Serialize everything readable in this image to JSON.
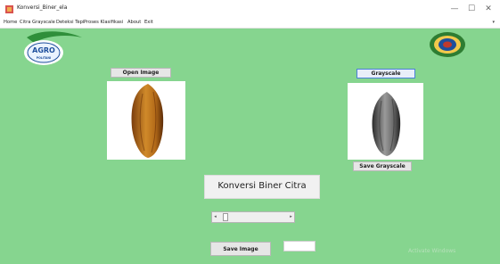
{
  "window": {
    "title": "Konversi_Biner_ela",
    "minimize_label": "—",
    "maximize_label": "☐",
    "close_label": "✕"
  },
  "menu": {
    "items": [
      {
        "label": "Home"
      },
      {
        "label": "Citra Grayscale"
      },
      {
        "label": "Deteksi Tepi"
      },
      {
        "label": "Proses Klasifikasi"
      },
      {
        "label": "About"
      },
      {
        "label": "Exit"
      }
    ],
    "overflow_label": "▾"
  },
  "logos": {
    "agro_text": "AGRO",
    "agro_subtext": "POLITANI"
  },
  "buttons": {
    "open_image": "Open Image",
    "grayscale": "Grayscale",
    "save_grayscale": "Save Grayscale",
    "save_image": "Save Image"
  },
  "main": {
    "title": "Konversi Biner Citra"
  },
  "slider": {
    "left_arrow": "◂",
    "right_arrow": "▸",
    "value_fraction": 0.05
  },
  "result": {
    "value": ""
  },
  "watermark": {
    "text": "Activate Windows"
  },
  "colors": {
    "canvas_bg": "#86d58f",
    "button_bg": "#e6e6e6",
    "grayscale_outline": "#4a7fd8"
  }
}
